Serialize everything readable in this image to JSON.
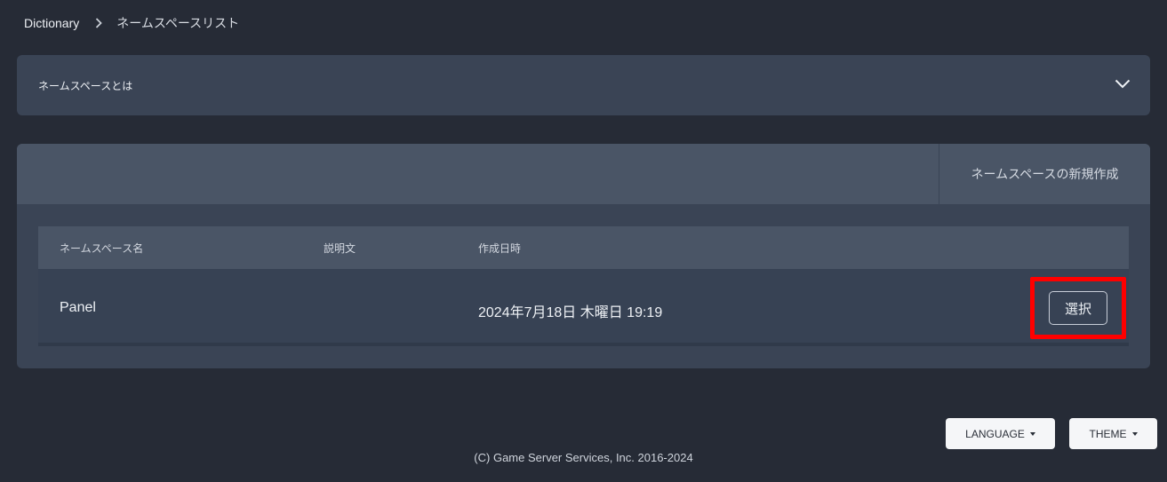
{
  "breadcrumb": {
    "root": "Dictionary",
    "current": "ネームスペースリスト"
  },
  "accordion": {
    "title": "ネームスペースとは"
  },
  "panel": {
    "create_button": "ネームスペースの新規作成"
  },
  "table": {
    "headers": {
      "name": "ネームスペース名",
      "description": "説明文",
      "created_at": "作成日時"
    },
    "rows": [
      {
        "name": "Panel",
        "description": "",
        "created_at": "2024年7月18日 木曜日 19:19",
        "action": "選択"
      }
    ]
  },
  "footer": {
    "copyright": "(C) Game Server Services, Inc. 2016-2024",
    "language_button": "LANGUAGE",
    "theme_button": "THEME"
  },
  "colors": {
    "background": "#262b36",
    "card": "#3a4455",
    "card_header": "#4a5566",
    "highlight": "#ff0000"
  }
}
